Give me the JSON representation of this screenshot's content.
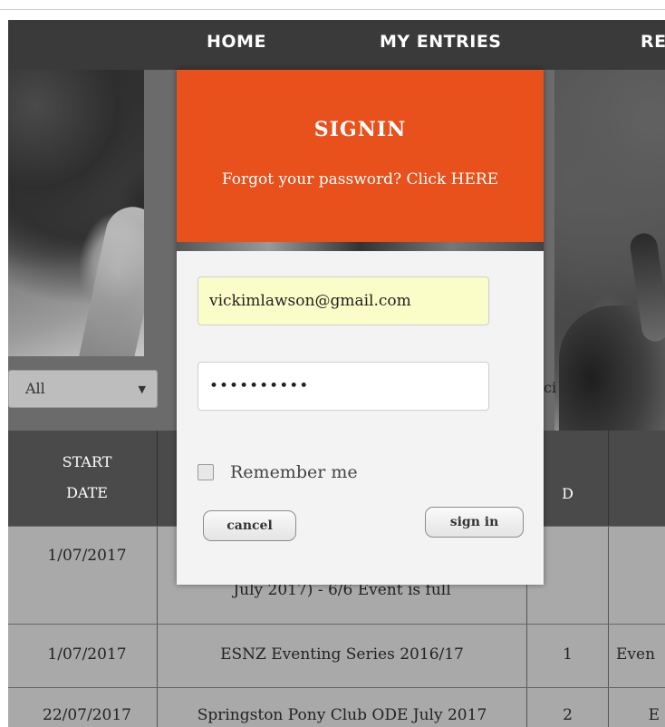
{
  "nav": {
    "items": [
      "HOME",
      "MY ENTRIES",
      "RE"
    ]
  },
  "filter": {
    "selected": "All",
    "behind_text": "ci"
  },
  "table": {
    "headers": {
      "start_date": [
        "START",
        "DATE"
      ],
      "obscured": "D"
    },
    "rows": [
      {
        "date": "1/07/2017",
        "name": "July 2017) - 6/6 Event is full",
        "num": "",
        "type": ""
      },
      {
        "date": "1/07/2017",
        "name": "ESNZ Eventing Series 2016/17",
        "num": "1",
        "type": "Even"
      },
      {
        "date": "22/07/2017",
        "name": "Springston Pony Club ODE July 2017",
        "num": "2",
        "type": "E"
      }
    ]
  },
  "modal": {
    "title": "SIGNIN",
    "forgot_link": "Forgot your password? Click HERE",
    "email_value": "vickimlawson@gmail.com",
    "password_mask": "••••••••••",
    "remember_label": "Remember me",
    "cancel_label": "cancel",
    "signin_label": "sign in"
  },
  "colors": {
    "accent": "#e8501c",
    "nav_bg": "#3a3a3a",
    "autofill": "#fbfdc8"
  }
}
